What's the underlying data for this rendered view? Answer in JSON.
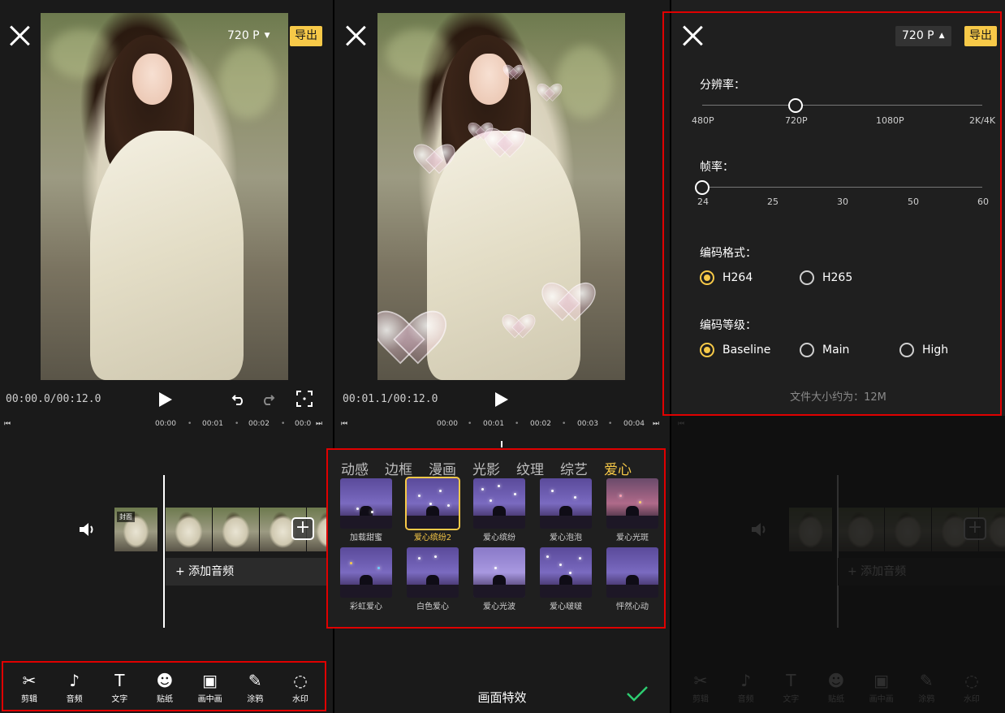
{
  "editor": {
    "resolution_chip": "720 P",
    "export_label": "导出",
    "time": "00:00.0/00:12.0",
    "ruler": [
      "00:00",
      "00:01",
      "00:02",
      "00:0"
    ],
    "cover_label": "封面",
    "add_audio": "+ 添加音频",
    "tools": [
      {
        "icon": "scissors-icon",
        "glyph": "✂",
        "label": "剪辑"
      },
      {
        "icon": "music-note-icon",
        "glyph": "♪",
        "label": "音频"
      },
      {
        "icon": "text-icon",
        "glyph": "T",
        "label": "文字"
      },
      {
        "icon": "smiley-icon",
        "glyph": "☻",
        "label": "贴纸"
      },
      {
        "icon": "pip-icon",
        "glyph": "▣",
        "label": "画中画"
      },
      {
        "icon": "doodle-icon",
        "glyph": "✎",
        "label": "涂鸦"
      },
      {
        "icon": "drop-icon",
        "glyph": "◌",
        "label": "水印"
      }
    ]
  },
  "effects": {
    "time": "00:01.1/00:12.0",
    "ruler": [
      "00:00",
      "00:01",
      "00:02",
      "00:03",
      "00:04"
    ],
    "tabs": [
      "动感",
      "边框",
      "漫画",
      "光影",
      "纹理",
      "综艺",
      "爱心"
    ],
    "active_tab": 6,
    "items": [
      "加载甜蜜",
      "爱心缤纷2",
      "爱心缤纷",
      "爱心泡泡",
      "爱心光斑",
      "彩虹爱心",
      "白色爱心",
      "爱心光波",
      "爱心啵啵",
      "怦然心动"
    ],
    "selected_item": 1,
    "panel_title": "画面特效"
  },
  "export": {
    "resolution_chip": "720 P",
    "export_label": "导出",
    "resolution": {
      "label": "分辨率：",
      "ticks": [
        "480P",
        "720P",
        "1080P",
        "2K/4K"
      ],
      "selected_fraction": 0.333
    },
    "framerate": {
      "label": "帧率：",
      "ticks": [
        "24",
        "25",
        "30",
        "50",
        "60"
      ],
      "selected_fraction": 0
    },
    "codec": {
      "label": "编码格式：",
      "options": [
        "H264",
        "H265"
      ],
      "selected": "H264"
    },
    "profile": {
      "label": "编码等级：",
      "options": [
        "Baseline",
        "Main",
        "High"
      ],
      "selected": "Baseline"
    },
    "file_size": "文件大小约为：12M",
    "bg_add_audio": "+ 添加音频"
  },
  "colors": {
    "accent": "#f7c948",
    "highlight_border": "#e00000",
    "confirm": "#2ecc71"
  }
}
